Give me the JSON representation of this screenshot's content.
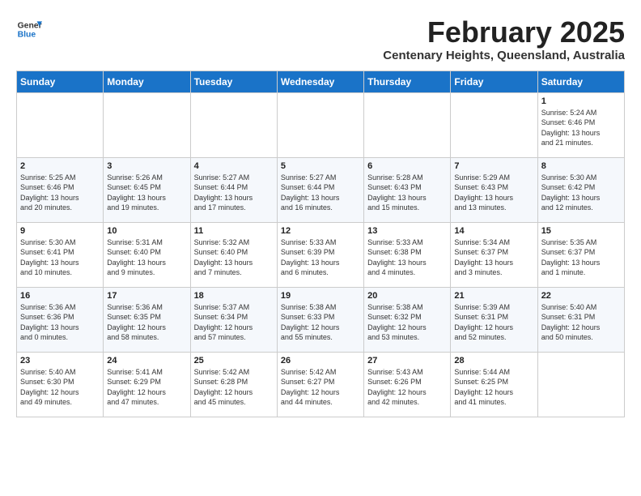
{
  "logo": {
    "line1": "General",
    "line2": "Blue"
  },
  "title": "February 2025",
  "subtitle": "Centenary Heights, Queensland, Australia",
  "weekdays": [
    "Sunday",
    "Monday",
    "Tuesday",
    "Wednesday",
    "Thursday",
    "Friday",
    "Saturday"
  ],
  "weeks": [
    [
      {
        "day": "",
        "info": ""
      },
      {
        "day": "",
        "info": ""
      },
      {
        "day": "",
        "info": ""
      },
      {
        "day": "",
        "info": ""
      },
      {
        "day": "",
        "info": ""
      },
      {
        "day": "",
        "info": ""
      },
      {
        "day": "1",
        "info": "Sunrise: 5:24 AM\nSunset: 6:46 PM\nDaylight: 13 hours\nand 21 minutes."
      }
    ],
    [
      {
        "day": "2",
        "info": "Sunrise: 5:25 AM\nSunset: 6:46 PM\nDaylight: 13 hours\nand 20 minutes."
      },
      {
        "day": "3",
        "info": "Sunrise: 5:26 AM\nSunset: 6:45 PM\nDaylight: 13 hours\nand 19 minutes."
      },
      {
        "day": "4",
        "info": "Sunrise: 5:27 AM\nSunset: 6:44 PM\nDaylight: 13 hours\nand 17 minutes."
      },
      {
        "day": "5",
        "info": "Sunrise: 5:27 AM\nSunset: 6:44 PM\nDaylight: 13 hours\nand 16 minutes."
      },
      {
        "day": "6",
        "info": "Sunrise: 5:28 AM\nSunset: 6:43 PM\nDaylight: 13 hours\nand 15 minutes."
      },
      {
        "day": "7",
        "info": "Sunrise: 5:29 AM\nSunset: 6:43 PM\nDaylight: 13 hours\nand 13 minutes."
      },
      {
        "day": "8",
        "info": "Sunrise: 5:30 AM\nSunset: 6:42 PM\nDaylight: 13 hours\nand 12 minutes."
      }
    ],
    [
      {
        "day": "9",
        "info": "Sunrise: 5:30 AM\nSunset: 6:41 PM\nDaylight: 13 hours\nand 10 minutes."
      },
      {
        "day": "10",
        "info": "Sunrise: 5:31 AM\nSunset: 6:40 PM\nDaylight: 13 hours\nand 9 minutes."
      },
      {
        "day": "11",
        "info": "Sunrise: 5:32 AM\nSunset: 6:40 PM\nDaylight: 13 hours\nand 7 minutes."
      },
      {
        "day": "12",
        "info": "Sunrise: 5:33 AM\nSunset: 6:39 PM\nDaylight: 13 hours\nand 6 minutes."
      },
      {
        "day": "13",
        "info": "Sunrise: 5:33 AM\nSunset: 6:38 PM\nDaylight: 13 hours\nand 4 minutes."
      },
      {
        "day": "14",
        "info": "Sunrise: 5:34 AM\nSunset: 6:37 PM\nDaylight: 13 hours\nand 3 minutes."
      },
      {
        "day": "15",
        "info": "Sunrise: 5:35 AM\nSunset: 6:37 PM\nDaylight: 13 hours\nand 1 minute."
      }
    ],
    [
      {
        "day": "16",
        "info": "Sunrise: 5:36 AM\nSunset: 6:36 PM\nDaylight: 13 hours\nand 0 minutes."
      },
      {
        "day": "17",
        "info": "Sunrise: 5:36 AM\nSunset: 6:35 PM\nDaylight: 12 hours\nand 58 minutes."
      },
      {
        "day": "18",
        "info": "Sunrise: 5:37 AM\nSunset: 6:34 PM\nDaylight: 12 hours\nand 57 minutes."
      },
      {
        "day": "19",
        "info": "Sunrise: 5:38 AM\nSunset: 6:33 PM\nDaylight: 12 hours\nand 55 minutes."
      },
      {
        "day": "20",
        "info": "Sunrise: 5:38 AM\nSunset: 6:32 PM\nDaylight: 12 hours\nand 53 minutes."
      },
      {
        "day": "21",
        "info": "Sunrise: 5:39 AM\nSunset: 6:31 PM\nDaylight: 12 hours\nand 52 minutes."
      },
      {
        "day": "22",
        "info": "Sunrise: 5:40 AM\nSunset: 6:31 PM\nDaylight: 12 hours\nand 50 minutes."
      }
    ],
    [
      {
        "day": "23",
        "info": "Sunrise: 5:40 AM\nSunset: 6:30 PM\nDaylight: 12 hours\nand 49 minutes."
      },
      {
        "day": "24",
        "info": "Sunrise: 5:41 AM\nSunset: 6:29 PM\nDaylight: 12 hours\nand 47 minutes."
      },
      {
        "day": "25",
        "info": "Sunrise: 5:42 AM\nSunset: 6:28 PM\nDaylight: 12 hours\nand 45 minutes."
      },
      {
        "day": "26",
        "info": "Sunrise: 5:42 AM\nSunset: 6:27 PM\nDaylight: 12 hours\nand 44 minutes."
      },
      {
        "day": "27",
        "info": "Sunrise: 5:43 AM\nSunset: 6:26 PM\nDaylight: 12 hours\nand 42 minutes."
      },
      {
        "day": "28",
        "info": "Sunrise: 5:44 AM\nSunset: 6:25 PM\nDaylight: 12 hours\nand 41 minutes."
      },
      {
        "day": "",
        "info": ""
      }
    ]
  ]
}
